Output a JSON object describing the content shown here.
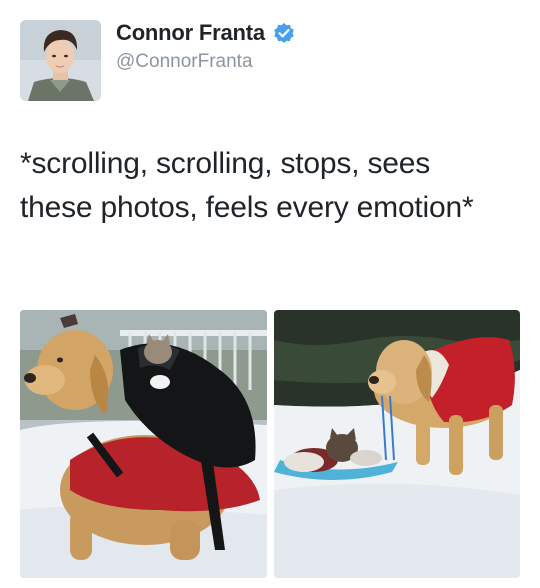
{
  "tweet": {
    "author": {
      "display_name": "Connor Franta",
      "handle": "@ConnorFranta",
      "verified": true,
      "verified_icon": "verified-badge-icon"
    },
    "text": "*scrolling, scrolling, stops, sees these photos, feels every emotion*",
    "photos": [
      {
        "subject": "golden retriever in red sweater carrying backpack with cat"
      },
      {
        "subject": "golden retriever in red sweater pulling cat on blue sled in snow"
      }
    ]
  },
  "colors": {
    "text": "#1f2429",
    "secondary_text": "#8b959e",
    "verified_blue": "#4aa0e8",
    "background": "#ffffff"
  }
}
